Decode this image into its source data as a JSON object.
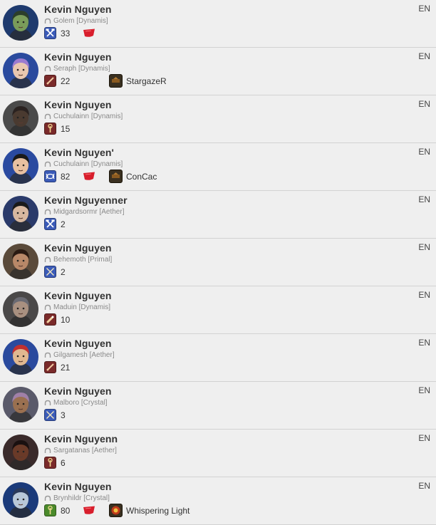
{
  "players": [
    {
      "name": "Kevin Nguyen",
      "server": "Golem [Dynamis]",
      "level": "33",
      "lang": "EN",
      "job_icon": "tool-crossed-icon",
      "job_color": "#3b5bb8",
      "crystal": true,
      "fc_name": "",
      "skin": "#7a9c5a",
      "hair": "#2c3e2a",
      "bg": "#1e3a6e"
    },
    {
      "name": "Kevin Nguyen",
      "server": "Seraph [Dynamis]",
      "level": "22",
      "lang": "EN",
      "job_icon": "sword-icon",
      "job_color": "#7a2a2a",
      "crystal": false,
      "fc_name": "StargazeR",
      "skin": "#e9c7b0",
      "hair": "#9b7bd0",
      "bg": "#2a4a9e"
    },
    {
      "name": "Kevin Nguyen",
      "server": "Cuchulainn [Dynamis]",
      "level": "15",
      "lang": "EN",
      "job_icon": "rod-icon",
      "job_color": "#7a2a2a",
      "crystal": false,
      "fc_name": "",
      "skin": "#4a3a30",
      "hair": "#2a2220",
      "bg": "#4a4a4a"
    },
    {
      "name": "Kevin Nguyen'",
      "server": "Cuchulainn [Dynamis]",
      "level": "82",
      "lang": "EN",
      "job_icon": "chakram-icon",
      "job_color": "#3b5bb8",
      "crystal": true,
      "fc_name": "ConCac",
      "skin": "#e8c0a0",
      "hair": "#1a1a1a",
      "bg": "#2a4aa0"
    },
    {
      "name": "Kevin Nguyenner",
      "server": "Midgardsormr [Aether]",
      "level": "2",
      "lang": "EN",
      "job_icon": "tool-crossed-icon",
      "job_color": "#3b5bb8",
      "crystal": false,
      "fc_name": "",
      "skin": "#d8b8a0",
      "hair": "#1a1a1a",
      "bg": "#2a3a6a"
    },
    {
      "name": "Kevin Nguyen",
      "server": "Behemoth [Primal]",
      "level": "2",
      "lang": "EN",
      "job_icon": "swords-crossed-icon",
      "job_color": "#3b5bb8",
      "crystal": false,
      "fc_name": "",
      "skin": "#b88868",
      "hair": "#2a1a12",
      "bg": "#5a4a3a"
    },
    {
      "name": "Kevin Nguyen",
      "server": "Maduin [Dynamis]",
      "level": "10",
      "lang": "EN",
      "job_icon": "flask-icon",
      "job_color": "#7a2a2a",
      "crystal": false,
      "fc_name": "",
      "skin": "#a89080",
      "hair": "#6a6a72",
      "bg": "#4a4848"
    },
    {
      "name": "Kevin Nguyen",
      "server": "Gilgamesh [Aether]",
      "level": "21",
      "lang": "EN",
      "job_icon": "sword-icon",
      "job_color": "#7a2a2a",
      "crystal": false,
      "fc_name": "",
      "skin": "#e0b890",
      "hair": "#c03030",
      "bg": "#2a4a9e"
    },
    {
      "name": "Kevin Nguyen",
      "server": "Malboro [Crystal]",
      "level": "3",
      "lang": "EN",
      "job_icon": "swords-crossed-icon",
      "job_color": "#3b5bb8",
      "crystal": false,
      "fc_name": "",
      "skin": "#9a7050",
      "hair": "#a080a8",
      "bg": "#5a5a6a"
    },
    {
      "name": "Kevin Nguyenn",
      "server": "Sargatanas [Aether]",
      "level": "6",
      "lang": "EN",
      "job_icon": "rod-icon",
      "job_color": "#7a2a2a",
      "crystal": false,
      "fc_name": "",
      "skin": "#6a3a28",
      "hair": "#1a1010",
      "bg": "#3a2a2a"
    },
    {
      "name": "Kevin Nguyen",
      "server": "Brynhildr [Crystal]",
      "level": "80",
      "lang": "EN",
      "job_icon": "rod-icon",
      "job_color": "#4a8a2a",
      "crystal": true,
      "fc_name": "Whispering Light",
      "skin": "#b8c8d8",
      "hair": "#2a3a5a",
      "bg": "#1a3a7a"
    }
  ]
}
